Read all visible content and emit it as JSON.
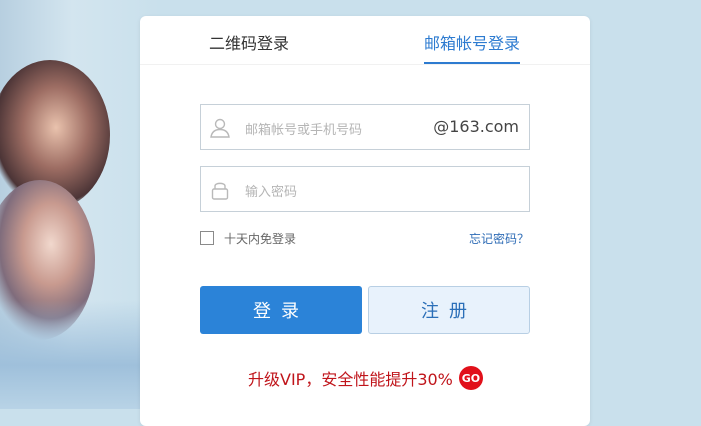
{
  "tabs": [
    {
      "label": "二维码登录",
      "active": false
    },
    {
      "label": "邮箱帐号登录",
      "active": true
    }
  ],
  "account_field": {
    "placeholder": "邮箱帐号或手机号码",
    "suffix": "@163.com",
    "icon": "user-icon"
  },
  "password_field": {
    "placeholder": "输入密码",
    "icon": "lock-icon"
  },
  "remember": {
    "label": "十天内免登录",
    "checked": false
  },
  "forgot_link": "忘记密码？",
  "buttons": {
    "login": "登录",
    "register": "注册"
  },
  "promo": {
    "text": "升级VIP，安全性能提升30%",
    "badge": "GO"
  },
  "colors": {
    "accent": "#2b83d8",
    "promo": "#c0151b",
    "background": "#c9e0ec"
  }
}
